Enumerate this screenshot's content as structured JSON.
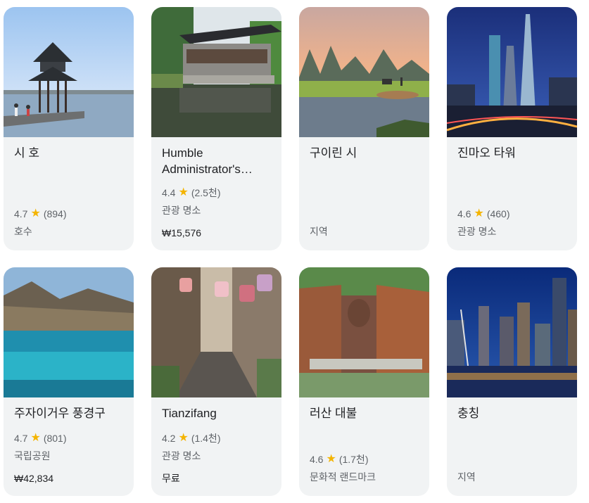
{
  "cards": [
    {
      "title": "시 호",
      "rating": "4.7",
      "reviews": "(894)",
      "category": "호수",
      "price": ""
    },
    {
      "title": "Humble Administrator's Garden",
      "rating": "4.4",
      "reviews": "(2.5천)",
      "category": "관광 명소",
      "price": "₩15,576"
    },
    {
      "title": "구이린 시",
      "rating": "",
      "reviews": "",
      "category": "지역",
      "price": ""
    },
    {
      "title": "진마오 타워",
      "rating": "4.6",
      "reviews": "(460)",
      "category": "관광 명소",
      "price": ""
    },
    {
      "title": "주자이거우 풍경구",
      "rating": "4.7",
      "reviews": "(801)",
      "category": "국립공원",
      "price": "₩42,834"
    },
    {
      "title": "Tianzifang",
      "rating": "4.2",
      "reviews": "(1.4천)",
      "category": "관광 명소",
      "price": "무료"
    },
    {
      "title": "러산 대불",
      "rating": "4.6",
      "reviews": "(1.7천)",
      "category": "문화적 랜드마크",
      "price": ""
    },
    {
      "title": "충칭",
      "rating": "",
      "reviews": "",
      "category": "지역",
      "price": ""
    }
  ],
  "icons": {
    "star": "star-icon"
  },
  "colors": {
    "star": "#f4b400",
    "card_bg": "#f1f3f4",
    "meta_text": "#5f6368"
  }
}
